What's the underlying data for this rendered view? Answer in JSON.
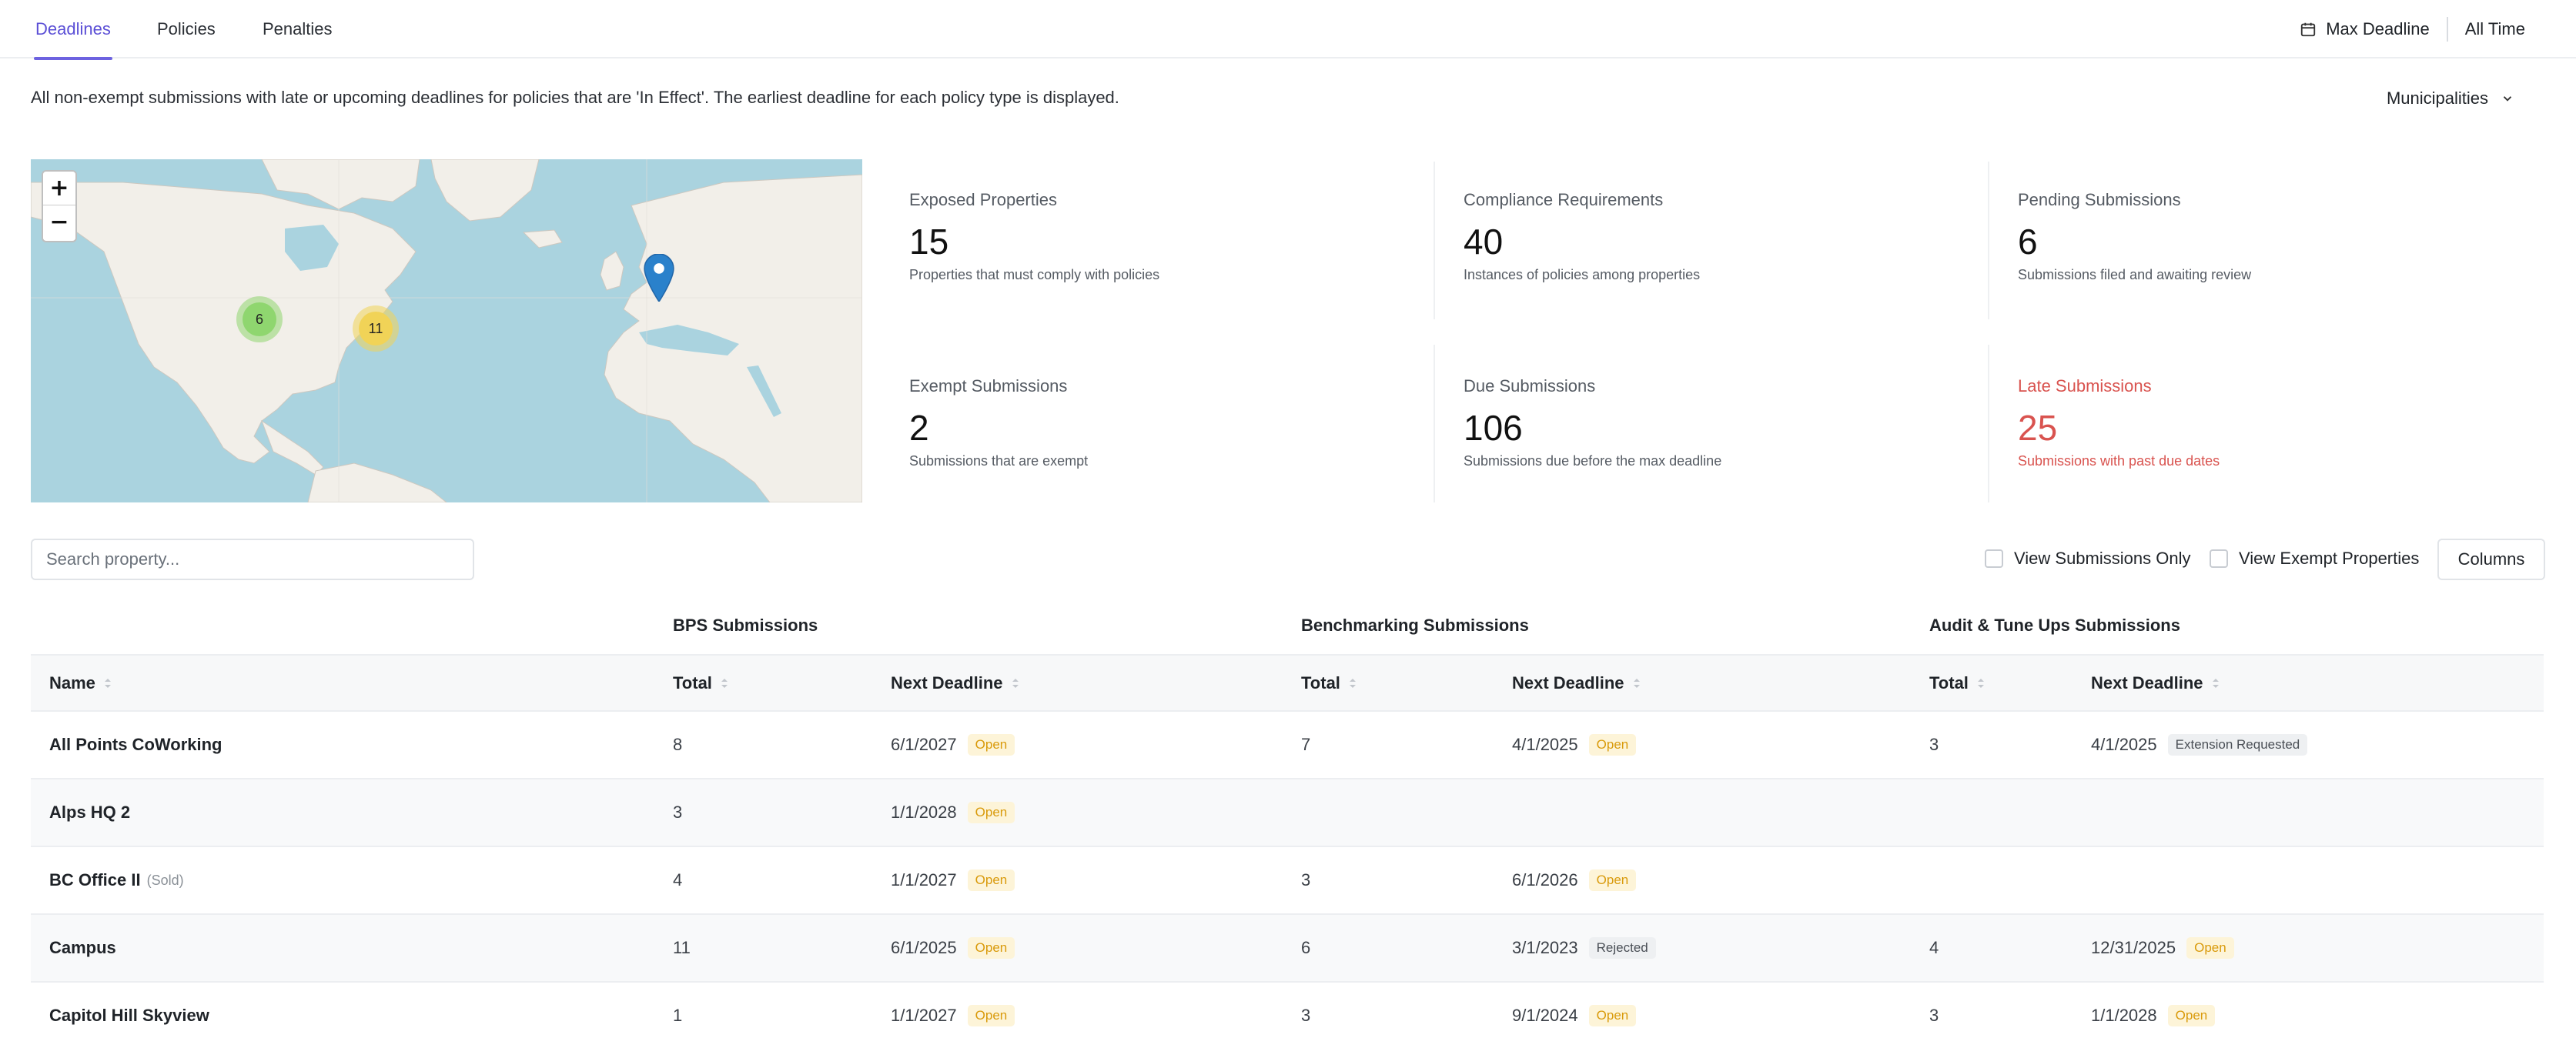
{
  "tabs": [
    {
      "label": "Deadlines",
      "active": true
    },
    {
      "label": "Policies",
      "active": false
    },
    {
      "label": "Penalties",
      "active": false
    }
  ],
  "header": {
    "max_deadline_label": "Max Deadline",
    "all_time_label": "All Time"
  },
  "description": "All non-exempt submissions with late or upcoming deadlines for policies that are 'In Effect'. The earliest deadline for each policy type is displayed.",
  "municipalities_label": "Municipalities",
  "map": {
    "zoom_in": "+",
    "zoom_out": "−",
    "clusters": [
      {
        "count": "6",
        "color": "#8fd66f"
      },
      {
        "count": "11",
        "color": "#f1d357"
      }
    ],
    "marker_color": "#2a81cb"
  },
  "stats": [
    {
      "label": "Exposed Properties",
      "value": "15",
      "sub": "Properties that must comply with policies"
    },
    {
      "label": "Compliance Requirements",
      "value": "40",
      "sub": "Instances of policies among properties"
    },
    {
      "label": "Pending Submissions",
      "value": "6",
      "sub": "Submissions filed and awaiting review"
    },
    {
      "label": "Exempt Submissions",
      "value": "2",
      "sub": "Submissions that are exempt"
    },
    {
      "label": "Due Submissions",
      "value": "106",
      "sub": "Submissions due before the max deadline"
    },
    {
      "label": "Late Submissions",
      "value": "25",
      "sub": "Submissions with past due dates",
      "accent": "#d9534f"
    }
  ],
  "search": {
    "placeholder": "Search property..."
  },
  "filters": {
    "submissions_only": "View Submissions Only",
    "exempt_properties": "View Exempt Properties",
    "columns_button": "Columns"
  },
  "table": {
    "groups": [
      "BPS Submissions",
      "Benchmarking Submissions",
      "Audit & Tune Ups Submissions"
    ],
    "columns": [
      "Name",
      "Total",
      "Next Deadline",
      "Total",
      "Next Deadline",
      "Total",
      "Next Deadline"
    ],
    "rows": [
      {
        "name": "All Points CoWorking",
        "note": "",
        "bps_total": "8",
        "bps_date": "6/1/2027",
        "bps_status": "Open",
        "bench_total": "7",
        "bench_date": "4/1/2025",
        "bench_status": "Open",
        "audit_total": "3",
        "audit_date": "4/1/2025",
        "audit_status": "Extension Requested"
      },
      {
        "name": "Alps HQ 2",
        "note": "",
        "bps_total": "3",
        "bps_date": "1/1/2028",
        "bps_status": "Open",
        "bench_total": "",
        "bench_date": "",
        "bench_status": "",
        "audit_total": "",
        "audit_date": "",
        "audit_status": ""
      },
      {
        "name": "BC Office II",
        "note": "(Sold)",
        "bps_total": "4",
        "bps_date": "1/1/2027",
        "bps_status": "Open",
        "bench_total": "3",
        "bench_date": "6/1/2026",
        "bench_status": "Open",
        "audit_total": "",
        "audit_date": "",
        "audit_status": ""
      },
      {
        "name": "Campus",
        "note": "",
        "bps_total": "11",
        "bps_date": "6/1/2025",
        "bps_status": "Open",
        "bench_total": "6",
        "bench_date": "3/1/2023",
        "bench_status": "Rejected",
        "audit_total": "4",
        "audit_date": "12/31/2025",
        "audit_status": "Open"
      },
      {
        "name": "Capitol Hill Skyview",
        "note": "",
        "bps_total": "1",
        "bps_date": "1/1/2027",
        "bps_status": "Open",
        "bench_total": "3",
        "bench_date": "9/1/2024",
        "bench_status": "Open",
        "audit_total": "3",
        "audit_date": "1/1/2028",
        "audit_status": "Open"
      }
    ]
  }
}
